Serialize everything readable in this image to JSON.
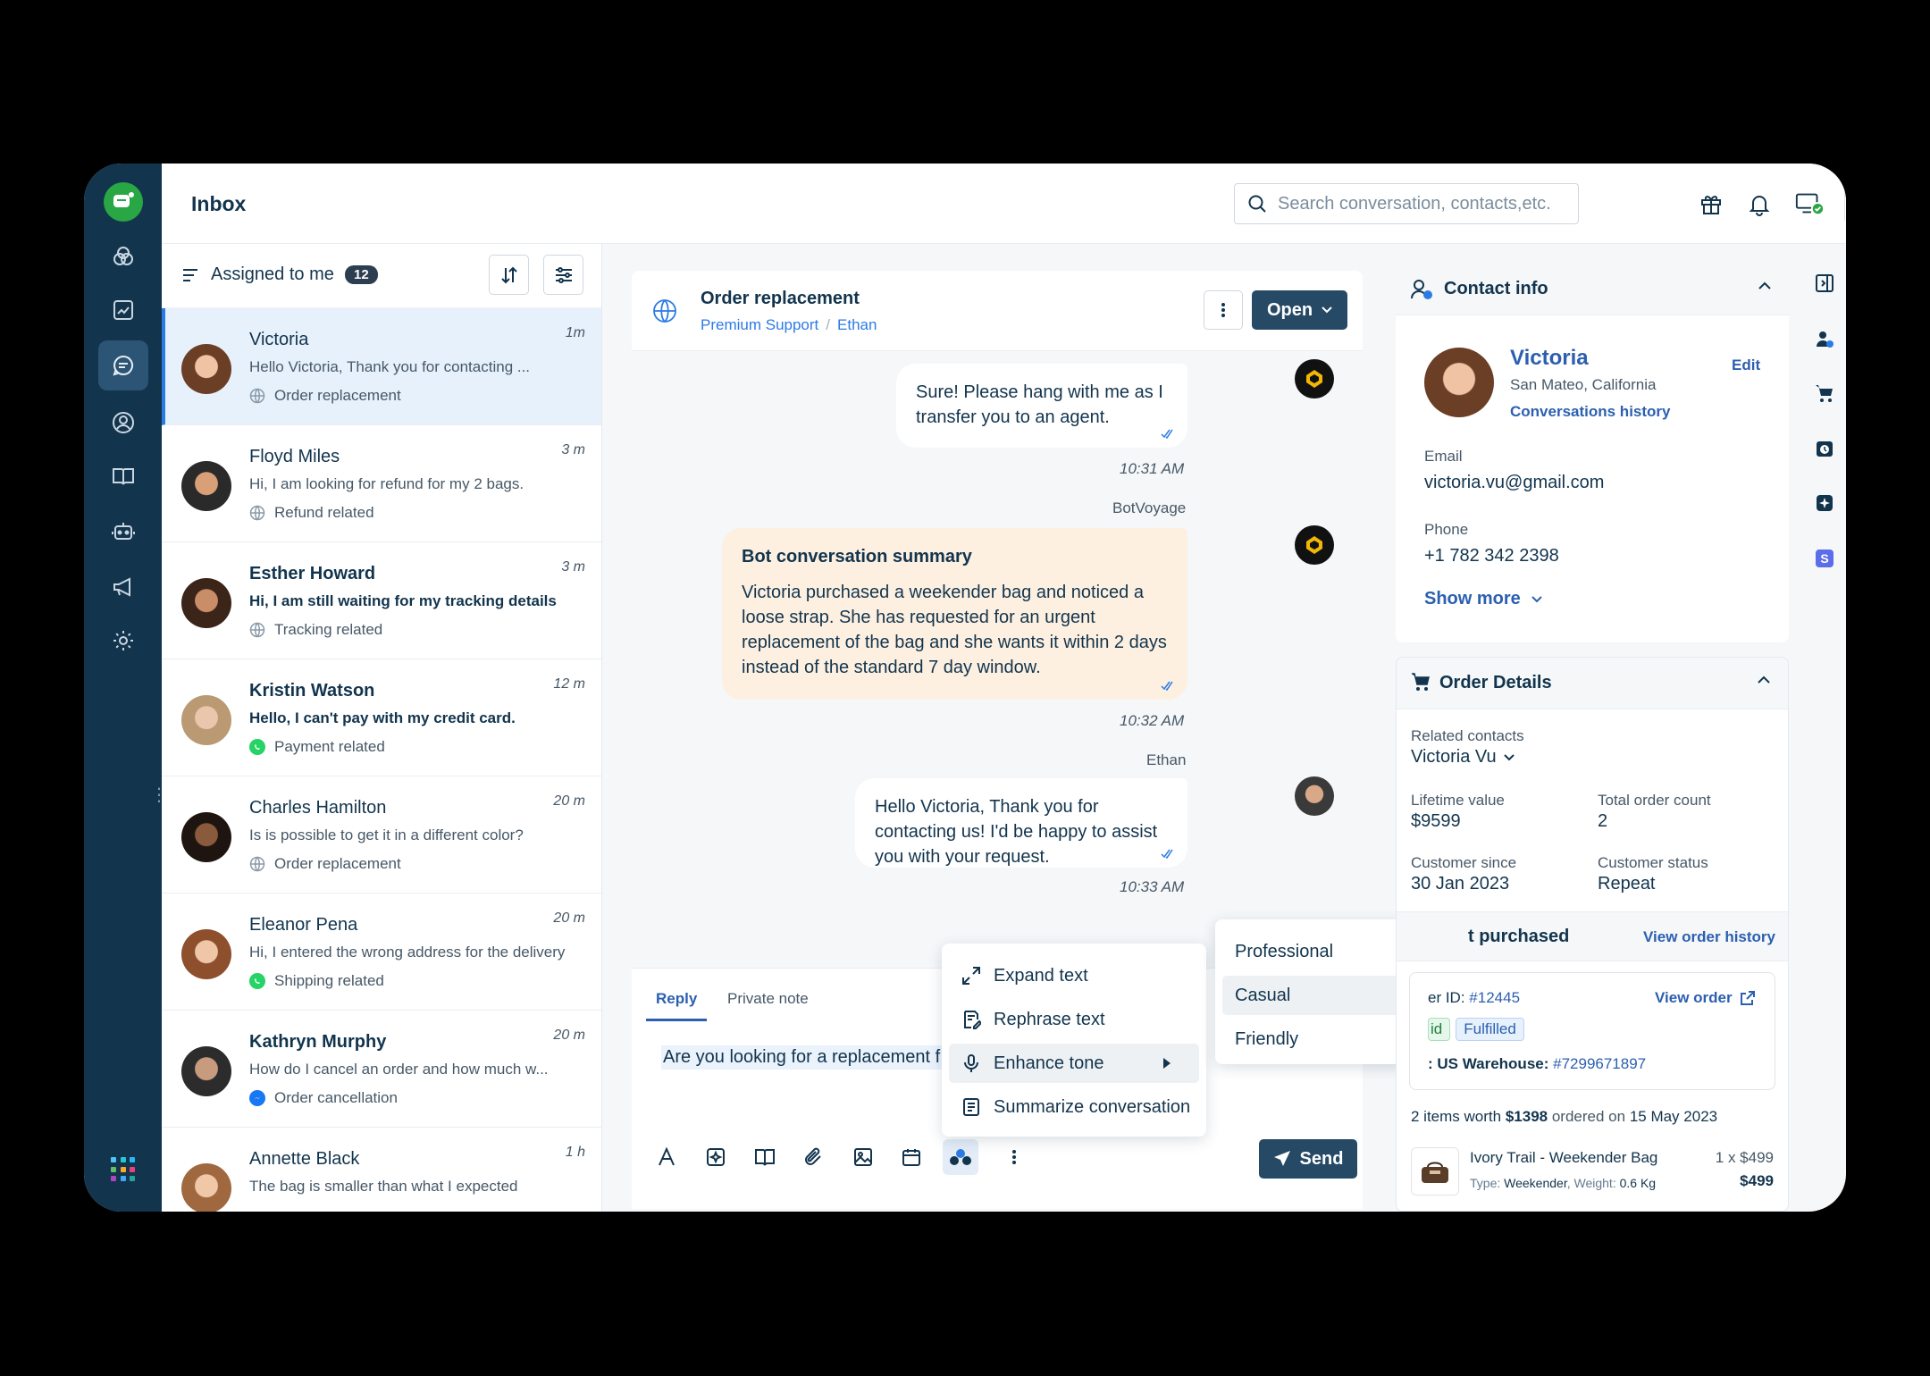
{
  "header": {
    "title": "Inbox",
    "search_placeholder": "Search conversation, contacts,etc."
  },
  "list": {
    "filter_label": "Assigned to me",
    "count": "12",
    "items": [
      {
        "name": "Victoria",
        "time": "1m",
        "preview": "Hello Victoria, Thank you for contacting ...",
        "tag": "Order replacement",
        "channel": "web"
      },
      {
        "name": "Floyd Miles",
        "time": "3 m",
        "preview": "Hi, I am looking for refund for my 2 bags.",
        "tag": "Refund related",
        "channel": "web"
      },
      {
        "name": "Esther Howard",
        "time": "3 m",
        "preview": "Hi, I am still waiting for my tracking details",
        "tag": "Tracking related",
        "channel": "web"
      },
      {
        "name": "Kristin Watson",
        "time": "12 m",
        "preview": "Hello, I can't pay with my credit card.",
        "tag": "Payment related",
        "channel": "whatsapp"
      },
      {
        "name": "Charles Hamilton",
        "time": "20 m",
        "preview": "Is is possible to get it in a different color?",
        "tag": "Order replacement",
        "channel": "web"
      },
      {
        "name": "Eleanor Pena",
        "time": "20 m",
        "preview": "Hi, I entered the wrong address for the delivery",
        "tag": "Shipping related",
        "channel": "whatsapp"
      },
      {
        "name": "Kathryn Murphy",
        "time": "20 m",
        "preview": "How do I cancel an order and how much w...",
        "tag": "Order cancellation",
        "channel": "facebook"
      },
      {
        "name": "Annette Black",
        "time": "1 h",
        "preview": "The bag is smaller than what I expected",
        "tag": "",
        "channel": "facebook"
      }
    ]
  },
  "chat": {
    "subject": "Order replacement",
    "group": "Premium Support",
    "agent": "Ethan",
    "status": "Open",
    "messages": [
      {
        "text": "Sure! Please hang with me as I transfer you to an agent.",
        "time": "10:31 AM"
      },
      {
        "sender": "BotVoyage",
        "title": "Bot conversation summary",
        "text": "Victoria purchased a weekender bag and noticed a loose strap. She has requested for an urgent replacement of the bag and she wants it within 2 days instead of the standard 7 day window.",
        "time": "10:32 AM"
      },
      {
        "sender": "Ethan",
        "text": "Hello Victoria, Thank you for contacting us! I'd be happy to assist you with your request.",
        "time": "10:33 AM"
      }
    ],
    "tabs": [
      "Reply",
      "Private note"
    ],
    "reply_text": "Are you looking for a replacement f",
    "send_label": "Send"
  },
  "ai_menu": {
    "items": [
      "Expand text",
      "Rephrase text",
      "Enhance tone",
      "Summarize conversation"
    ],
    "tones": [
      "Professional",
      "Casual",
      "Friendly"
    ]
  },
  "contact": {
    "title": "Contact info",
    "name": "Victoria",
    "location": "San Mateo, California",
    "history_link": "Conversations history",
    "edit_label": "Edit",
    "email_label": "Email",
    "email": "victoria.vu@gmail.com",
    "phone_label": "Phone",
    "phone": "+1 782 342 2398",
    "show_more": "Show more"
  },
  "order": {
    "title": "Order Details",
    "related_label": "Related contacts",
    "related_value": "Victoria Vu",
    "lifetime_label": "Lifetime value",
    "lifetime_value": "$9599",
    "count_label": "Total order count",
    "count_value": "2",
    "since_label": "Customer since",
    "since_value": "30 Jan 2023",
    "status_label": "Customer status",
    "status_value": "Repeat",
    "last_purchased": "t purchased",
    "view_history": "View order history",
    "order_id_label": "er ID:",
    "order_id": "#12445",
    "view_order": "View order",
    "paid_badge": "id",
    "fulfilled_badge": "Fulfilled",
    "warehouse_label": ": US Warehouse:",
    "warehouse_id": "#7299671897",
    "summary_items": "2 items worth",
    "summary_amount": "$1398",
    "summary_ordered": "ordered on",
    "summary_date": "15 May 2023",
    "product_name": "Ivory Trail - Weekender Bag",
    "product_meta_type_label": "Type:",
    "product_meta_type": "Weekender",
    "product_meta_weight_label": "Weight:",
    "product_meta_weight": "0.6 Kg",
    "product_qty": "1 x $499",
    "product_total": "$499"
  },
  "colors": {
    "rail": "#12344d",
    "accent": "#2c7be5",
    "primary_button": "#264966",
    "summary_bg": "#fdf0e1",
    "whatsapp": "#25d366",
    "facebook": "#1877f2"
  }
}
